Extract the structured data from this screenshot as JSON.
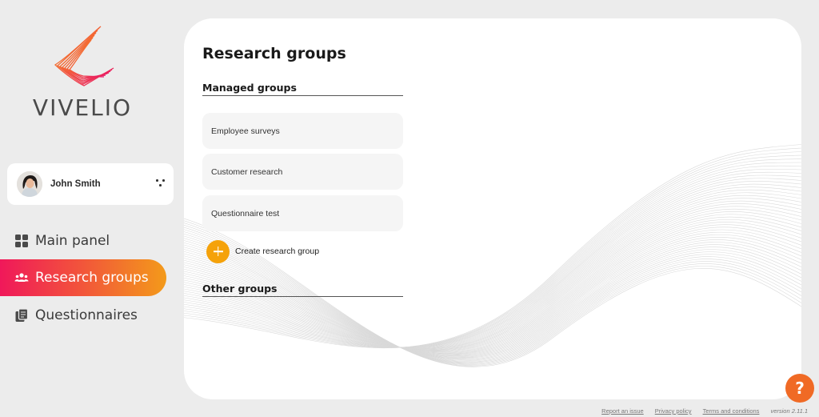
{
  "brand": {
    "name": "VIVELIO"
  },
  "user": {
    "name": "John Smith"
  },
  "nav": {
    "items": [
      {
        "label": "Main panel",
        "icon": "dashboard-icon"
      },
      {
        "label": "Research groups",
        "icon": "people-icon",
        "active": true
      },
      {
        "label": "Questionnaires",
        "icon": "copy-icon"
      }
    ]
  },
  "main": {
    "title": "Research groups",
    "managed_title": "Managed groups",
    "groups": [
      "Employee surveys",
      "Customer research",
      "Questionnaire test"
    ],
    "create_label": "Create research group",
    "other_title": "Other groups"
  },
  "help": {
    "label": "?"
  },
  "footer": {
    "report": "Report an issue",
    "privacy": "Privacy policy",
    "terms": "Terms and conditions",
    "version": "version 2.11.1"
  },
  "colors": {
    "accent_start": "#f0185a",
    "accent_end": "#f39a1a",
    "plus_button": "#f5a20a",
    "help_button": "#f06a25"
  }
}
